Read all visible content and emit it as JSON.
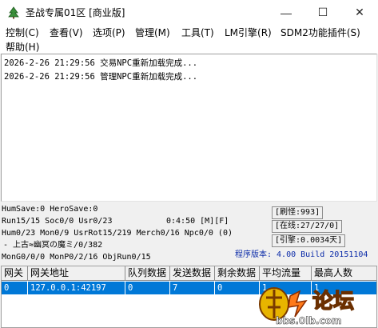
{
  "window": {
    "title": "圣战专属01区 [商业版]",
    "controls": {
      "minimize": "—",
      "maximize": "☐",
      "close": "✕"
    }
  },
  "menu": {
    "items": [
      "控制(C)",
      "查看(V)",
      "选项(P)",
      "管理(M)",
      "工具(T)",
      "LM引擎(R)",
      "SDM2功能插件(S)",
      "帮助(H)"
    ]
  },
  "log": {
    "lines": [
      "2026-2-26 21:29:56 交易NPC重新加载完成...",
      "2026-2-26 21:29:56 管理NPC重新加载完成..."
    ]
  },
  "status": {
    "hum_save": "HumSave:0 HeroSave:0",
    "run": "Run15/15 Soc0/0 Usr0/23",
    "time": "0:4:50 [M][F]",
    "refresh": "[刷怪:993]",
    "hum": "Hum0/23 Mon0/9 UsrRot15/219 Merch0/16 Npc0/0 (0)",
    "online": "[在线:27/27/0]",
    "map": "- 上古≈幽冥の魔ミ/0/382",
    "engine": "[引擎:0.0034天]",
    "mongo": "MonG0/0/0 MonP0/2/16 ObjRun0/15",
    "version": "程序版本: 4.00 Build 20151104"
  },
  "grid": {
    "headers": [
      "网关",
      "网关地址",
      "队列数据",
      "发送数据",
      "剩余数据",
      "平均流量",
      "最高人数"
    ],
    "rows": [
      [
        "0",
        "127.0.0.1:42197",
        "0",
        "7",
        "0",
        "1",
        "1"
      ]
    ]
  },
  "watermark": {
    "text": "论坛",
    "url": "bbs.0lb.com"
  },
  "colors": {
    "selection": "#0078d7",
    "version_text": "#0a2aa8"
  }
}
